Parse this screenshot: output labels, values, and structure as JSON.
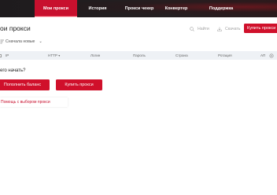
{
  "nav": {
    "items": [
      {
        "label": "Мои прокси",
        "active": true
      },
      {
        "label": "История",
        "active": false
      },
      {
        "label": "Прокси чекер",
        "active": false
      },
      {
        "label": "Конвертер",
        "active": false
      },
      {
        "label": "Поддержка",
        "active": false
      }
    ]
  },
  "page": {
    "title": "ои прокси",
    "sort_label": "Сначала новые",
    "tools": {
      "find_label": "Найти",
      "download_label": "Скачать",
      "buy_label": "Купить прокси"
    }
  },
  "table": {
    "columns": [
      "IP",
      "HTTP",
      "Логин",
      "Пароль",
      "Страна",
      "Ротация",
      "АП"
    ]
  },
  "empty_state": {
    "question": "его начать?",
    "topup_label": "Пополнить баланс",
    "buy_label": "Купить прокси",
    "help_label": "Помощь с выбором прокси"
  },
  "colors": {
    "accent": "#d0102b",
    "topbar": "#201d1f",
    "table_header": "#eef1f5"
  }
}
